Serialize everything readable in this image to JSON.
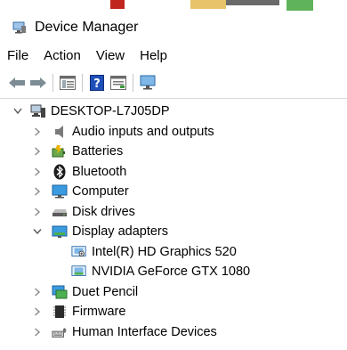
{
  "window": {
    "title": "Device Manager"
  },
  "menu": {
    "file": "File",
    "action": "Action",
    "view": "View",
    "help": "Help"
  },
  "toolbar": {
    "icons": [
      "back-arrow-icon",
      "forward-arrow-icon",
      "show-hide-tree-icon",
      "help-icon",
      "properties-icon",
      "scan-hardware-icon"
    ]
  },
  "tree": {
    "root": "DESKTOP-L7J05DP",
    "items": [
      {
        "label": "Audio inputs and outputs"
      },
      {
        "label": "Batteries"
      },
      {
        "label": "Bluetooth"
      },
      {
        "label": "Computer"
      },
      {
        "label": "Disk drives"
      },
      {
        "label": "Display adapters",
        "children": [
          "Intel(R) HD Graphics 520",
          "NVIDIA GeForce GTX 1080"
        ]
      },
      {
        "label": "Duet Pencil"
      },
      {
        "label": "Firmware"
      },
      {
        "label": "Human Interface Devices"
      }
    ]
  },
  "colors": {
    "accent": "#1e78c8",
    "icon_gray": "#6d6d6d",
    "expander": "#808080"
  }
}
